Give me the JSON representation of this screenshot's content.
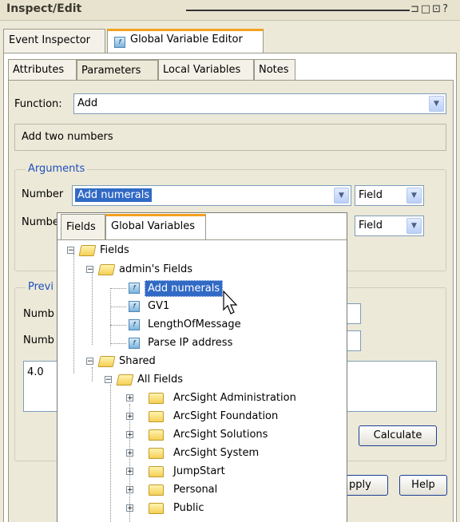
{
  "window": {
    "title": "Inspect/Edit",
    "controls": "⊐□⊡?"
  },
  "top_tabs": [
    {
      "label": "Event Inspector"
    },
    {
      "label": "Global Variable Editor",
      "icon": "fx-icon"
    }
  ],
  "sub_tabs": [
    {
      "label": "Attributes"
    },
    {
      "label": "Parameters"
    },
    {
      "label": "Local Variables"
    },
    {
      "label": "Notes"
    }
  ],
  "function": {
    "label": "Function:",
    "value": "Add"
  },
  "description": "Add two numbers",
  "arguments": {
    "title": "Arguments",
    "row1": {
      "label": "Number",
      "value": "Add numerals",
      "type": "Field"
    },
    "row2": {
      "label": "Numbe",
      "type": "Field"
    }
  },
  "preview": {
    "title": "Previ",
    "label1": "Numb",
    "label2": "Numb",
    "result": "4.0",
    "calculate_label": "Calculate"
  },
  "footer": {
    "apply_label": "pply",
    "help_label": "Help"
  },
  "popup": {
    "tabs": [
      {
        "label": "Fields"
      },
      {
        "label": "Global Variables"
      }
    ],
    "tree": {
      "root": "Fields",
      "admins_fields": "admin's Fields",
      "items": [
        "Add numerals",
        "GV1",
        "LengthOfMessage",
        "Parse IP address"
      ],
      "shared": "Shared",
      "all_fields": "All Fields",
      "groups": [
        "ArcSight Administration",
        "ArcSight Foundation",
        "ArcSight Solutions",
        "ArcSight System",
        "JumpStart",
        "Personal",
        "Public"
      ]
    }
  },
  "colors": {
    "accent_tab": "#f4a11e",
    "selection": "#316ac5",
    "group_title": "#1f4ebd"
  }
}
